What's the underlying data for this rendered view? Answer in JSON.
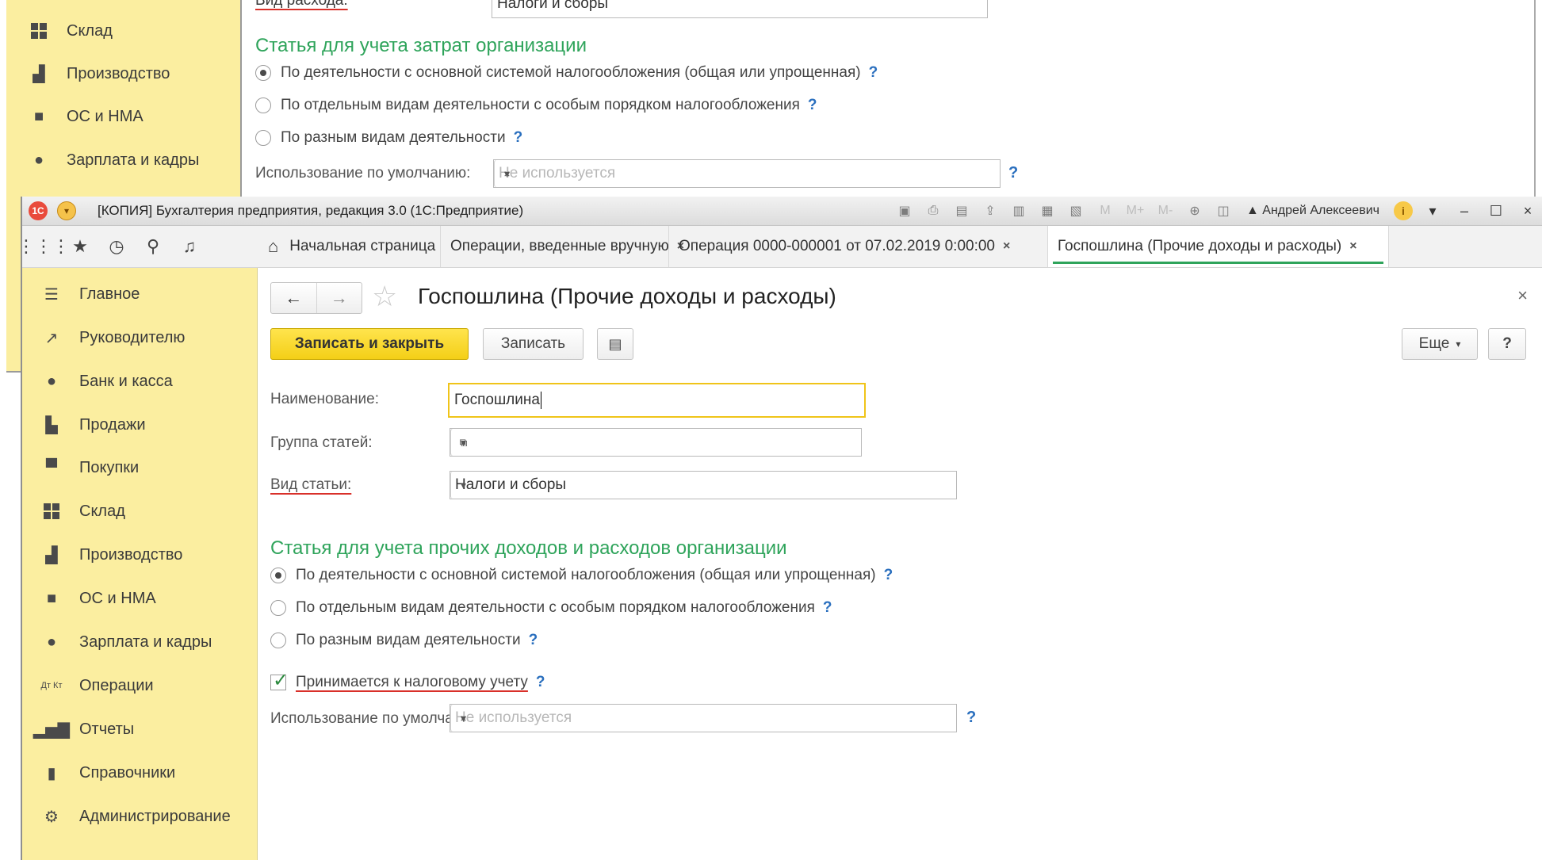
{
  "background": {
    "sidebar": [
      {
        "name": "sidebar-item-sklad",
        "icon": "warehouse-icon",
        "label": "Склад"
      },
      {
        "name": "sidebar-item-proizvodstvo",
        "icon": "factory-icon",
        "label": "Производство"
      },
      {
        "name": "sidebar-item-os",
        "icon": "truck-icon",
        "label": "ОС и НМА"
      },
      {
        "name": "sidebar-item-zarplata",
        "icon": "person-icon",
        "label": "Зарплата и кадры"
      }
    ],
    "top_label": "Вид расхода:",
    "top_select_value": "Налоги и сборы",
    "section_title": "Статья для учета затрат организации",
    "radios": [
      {
        "label": "По деятельности с основной системой налогообложения (общая или упрощенная)",
        "checked": true
      },
      {
        "label": "По отдельным видам деятельности с особым порядком налогообложения",
        "checked": false
      },
      {
        "label": "По разным видам деятельности",
        "checked": false
      }
    ],
    "default_label": "Использование по умолчанию:",
    "default_placeholder": "Не используется",
    "help": "?"
  },
  "window": {
    "title": "[КОПИЯ] Бухгалтерия предприятия, редакция 3.0  (1С:Предприятие)",
    "logo": "1С",
    "user": "Андрей Алексеевич",
    "memory": [
      "M",
      "M+",
      "M-"
    ]
  },
  "tabs": [
    {
      "label": "Начальная страница",
      "closable": false
    },
    {
      "label": "Операции, введенные вручную",
      "closable": true
    },
    {
      "label": "Операция 0000-000001 от 07.02.2019 0:00:00",
      "closable": true
    },
    {
      "label": "Госпошлина (Прочие доходы и расходы)",
      "closable": true
    }
  ],
  "close_glyph": "×",
  "sidebar": [
    {
      "name": "sidebar-item-glavnoe",
      "icon": "menu-icon",
      "label": "Главное"
    },
    {
      "name": "sidebar-item-rukovoditelyu",
      "icon": "trend-icon",
      "label": "Руководителю"
    },
    {
      "name": "sidebar-item-bank",
      "icon": "coin-icon",
      "label": "Банк и касса"
    },
    {
      "name": "sidebar-item-prodazhi",
      "icon": "bag-icon",
      "label": "Продажи"
    },
    {
      "name": "sidebar-item-pokupki",
      "icon": "cart-icon",
      "label": "Покупки"
    },
    {
      "name": "sidebar-item-sklad",
      "icon": "warehouse-icon",
      "label": "Склад"
    },
    {
      "name": "sidebar-item-proizvodstvo",
      "icon": "factory-icon",
      "label": "Производство"
    },
    {
      "name": "sidebar-item-os",
      "icon": "truck-icon",
      "label": "ОС и НМА"
    },
    {
      "name": "sidebar-item-zarplata",
      "icon": "person-icon",
      "label": "Зарплата и кадры"
    },
    {
      "name": "sidebar-item-operacii",
      "icon": "dtkt-icon",
      "label": "Операции"
    },
    {
      "name": "sidebar-item-otchety",
      "icon": "bar-chart-icon",
      "label": "Отчеты"
    },
    {
      "name": "sidebar-item-spravochniki",
      "icon": "book-icon",
      "label": "Справочники"
    },
    {
      "name": "sidebar-item-admin",
      "icon": "gear-icon",
      "label": "Администрирование"
    }
  ],
  "form": {
    "title": "Госпошлина (Прочие доходы и расходы)",
    "save_close": "Записать и закрыть",
    "save": "Записать",
    "more": "Еще",
    "help": "?",
    "name_label": "Наименование:",
    "name_value": "Госпошлина",
    "group_label": "Группа статей:",
    "group_value": "",
    "type_label": "Вид статьи:",
    "type_value": "Налоги и сборы",
    "section_title": "Статья для учета прочих доходов и расходов организации",
    "radios": [
      {
        "label": "По деятельности с основной системой налогообложения (общая или упрощенная)",
        "checked": true
      },
      {
        "label": "По отдельным видам деятельности с особым порядком налогообложения",
        "checked": false
      },
      {
        "label": "По разным видам деятельности",
        "checked": false
      }
    ],
    "tax_checkbox_label": "Принимается к налоговому учету",
    "tax_checkbox_checked": true,
    "default_label": "Использование по умолчанию:",
    "default_placeholder": "Не используется"
  },
  "colors": {
    "sidebar_bg": "#fbeea0",
    "section_green": "#2fa45b",
    "primary_yellow": "#f4cf17",
    "help_blue": "#2a6fbe",
    "underline_red": "#d9302a"
  }
}
